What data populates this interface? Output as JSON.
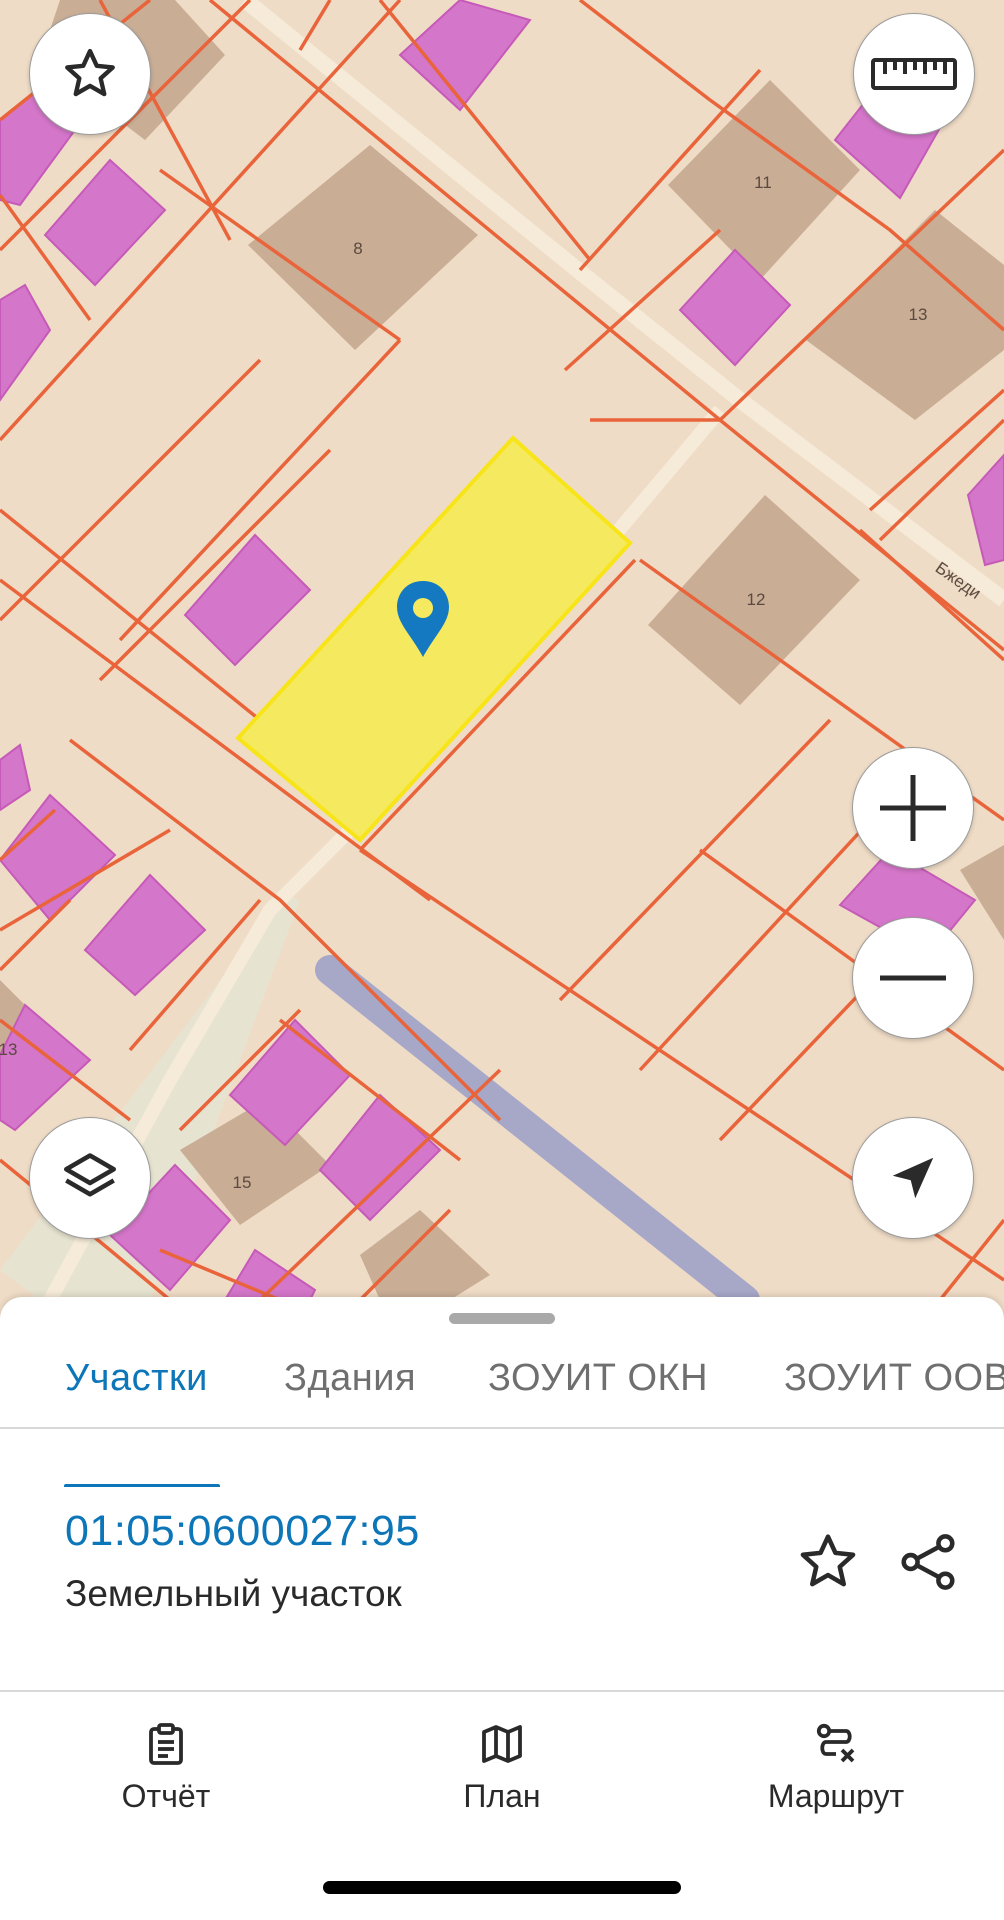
{
  "map": {
    "labels": {
      "lot_8": "8",
      "lot_11": "11",
      "lot_13": "13",
      "lot_12": "12",
      "lot_13b": "13",
      "lot_15": "15",
      "street": "Бжеди"
    },
    "colors": {
      "background": "#efdcc6",
      "parcel_border": "#e9643a",
      "building": "#d476c9",
      "selected_parcel": "#f5ea5f",
      "marker": "#1479c0"
    }
  },
  "map_controls": {
    "favorite": {
      "icon": "star-icon"
    },
    "ruler": {
      "icon": "ruler-icon"
    },
    "layers": {
      "icon": "layers-icon"
    },
    "zoom_in": {
      "icon": "plus-icon"
    },
    "zoom_out": {
      "icon": "minus-icon"
    },
    "locate": {
      "icon": "navigation-arrow-icon"
    }
  },
  "sheet": {
    "tabs": [
      {
        "label": "Участки",
        "active": true
      },
      {
        "label": "Здания",
        "active": false
      },
      {
        "label": "ЗОУИТ ОКН",
        "active": false
      },
      {
        "label": "ЗОУИТ ООВ",
        "active": false
      }
    ],
    "parcel": {
      "cadastral_number": "01:05:0600027:95",
      "type": "Земельный участок"
    }
  },
  "bottom_nav": {
    "items": [
      {
        "label": "Отчёт",
        "icon": "clipboard-icon"
      },
      {
        "label": "План",
        "icon": "map-icon"
      },
      {
        "label": "Маршрут",
        "icon": "route-icon"
      }
    ]
  }
}
